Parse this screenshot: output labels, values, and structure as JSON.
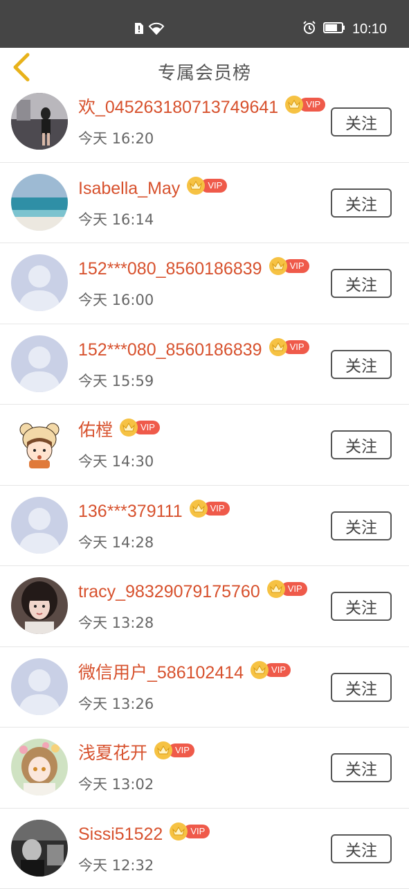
{
  "status_bar": {
    "time": "10:10",
    "icons": [
      "sim-alert-icon",
      "wifi-icon",
      "alarm-icon",
      "battery-icon"
    ]
  },
  "header": {
    "title": "专属会员榜",
    "back_icon": "chevron-left-icon",
    "accent_color": "#e8b21a"
  },
  "colors": {
    "name": "#d7512d",
    "vip_badge": "#ef5a4a",
    "crown": "#f6c243"
  },
  "vip_label": "VIP",
  "follow_label": "关注",
  "members": [
    {
      "name": "欢_045263180713749641",
      "time": "今天 16:20",
      "avatar": "photo-street"
    },
    {
      "name": "Isabella_May",
      "time": "今天 16:14",
      "avatar": "photo-beach"
    },
    {
      "name": "152***080_8560186839",
      "time": "今天 16:00",
      "avatar": "default-avatar"
    },
    {
      "name": "152***080_8560186839",
      "time": "今天 15:59",
      "avatar": "default-avatar"
    },
    {
      "name": "佑樘",
      "time": "今天 14:30",
      "avatar": "cartoon-bear-girl"
    },
    {
      "name": "136***379111",
      "time": "今天 14:28",
      "avatar": "default-avatar"
    },
    {
      "name": "tracy_98329079175760",
      "time": "今天 13:28",
      "avatar": "photo-girl-portrait"
    },
    {
      "name": "微信用户_586102414",
      "time": "今天 13:26",
      "avatar": "default-avatar"
    },
    {
      "name": "浅夏花开",
      "time": "今天 13:02",
      "avatar": "anime-girl"
    },
    {
      "name": "Sissi51522",
      "time": "今天 12:32",
      "avatar": "photo-bw"
    }
  ]
}
